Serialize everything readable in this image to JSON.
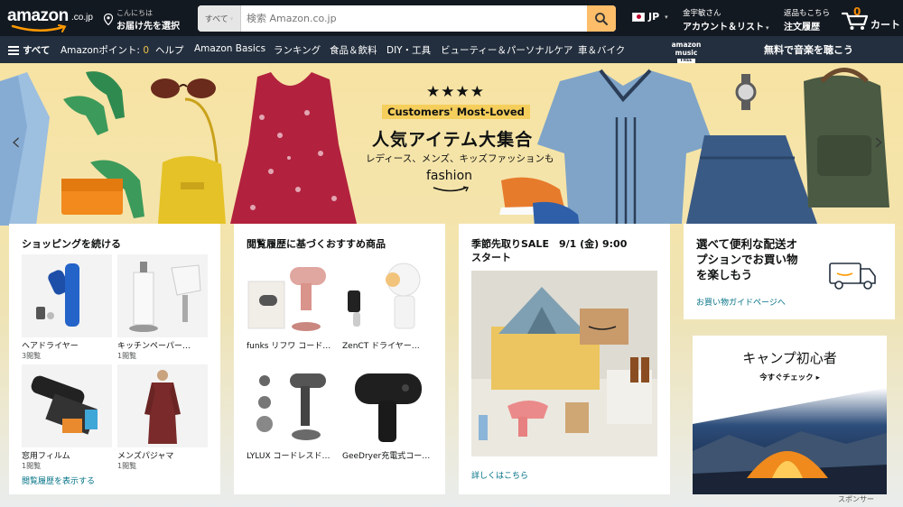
{
  "header": {
    "logo_text": "amazon",
    "logo_suffix": ".co.jp",
    "deliver_line1": "こんにちは",
    "deliver_line2": "お届け先を選択",
    "search_category": "すべて",
    "search_placeholder": "検索 Amazon.co.jp",
    "language": "JP",
    "account_line1": "金宇敏さん",
    "account_line2": "アカウント＆リスト",
    "orders_line1": "返品もこちら",
    "orders_line2": "注文履歴",
    "cart_count": "0",
    "cart_label": "カート"
  },
  "subnav": {
    "all_label": "すべて",
    "points_label": "Amazonポイント:",
    "points_value": "0",
    "items": [
      "ヘルプ",
      "Amazon Basics",
      "ランキング",
      "食品＆飲料",
      "DIY・工具",
      "ビューティー＆パーソナルケア",
      "車＆バイク"
    ],
    "music_logo": "amazon music",
    "music_badge": "FREE",
    "music_cta": "無料で音楽を聴こう"
  },
  "hero": {
    "stars": "★★★★",
    "tag": "Customers' Most-Loved",
    "title": "人気アイテム大集合",
    "subtitle": "レディース、メンズ、キッズファッションも",
    "brand": "fashion"
  },
  "cards": {
    "continue": {
      "title": "ショッピングを続ける",
      "items": [
        {
          "name": "ヘアドライヤー",
          "sub": "3閲覧"
        },
        {
          "name": "キッチンペーパー…",
          "sub": "1閲覧"
        },
        {
          "name": "窓用フィルム",
          "sub": "1閲覧"
        },
        {
          "name": "メンズパジャマ",
          "sub": "1閲覧"
        }
      ],
      "link": "閲覧履歴を表示する"
    },
    "recommend": {
      "title": "閲覧履歴に基づくおすすめ商品",
      "items": [
        {
          "name": "funks リフワ コード…"
        },
        {
          "name": "ZenCT ドライヤー…"
        },
        {
          "name": "LYLUX コードレスド…"
        },
        {
          "name": "GeeDryer充電式コー…"
        }
      ]
    },
    "seasonal": {
      "title_line1": "季節先取りSALE　9/1 (金) 9:00",
      "title_line2": "スタート",
      "link": "詳しくはこちら"
    },
    "delivery": {
      "title_line1": "選べて便利な配送オ",
      "title_line2": "プションでお買い物",
      "title_line3": "を楽しもう",
      "link": "お買い物ガイドページへ"
    },
    "camp": {
      "title": "キャンプ初心者",
      "cta": "今すぐチェック ▸"
    }
  },
  "sponsor_label": "スポンサー",
  "colors": {
    "nav_dark": "#131921",
    "nav_sub": "#232f3e",
    "search_button": "#febd69",
    "accent_orange": "#ff9900",
    "link": "#007185"
  }
}
